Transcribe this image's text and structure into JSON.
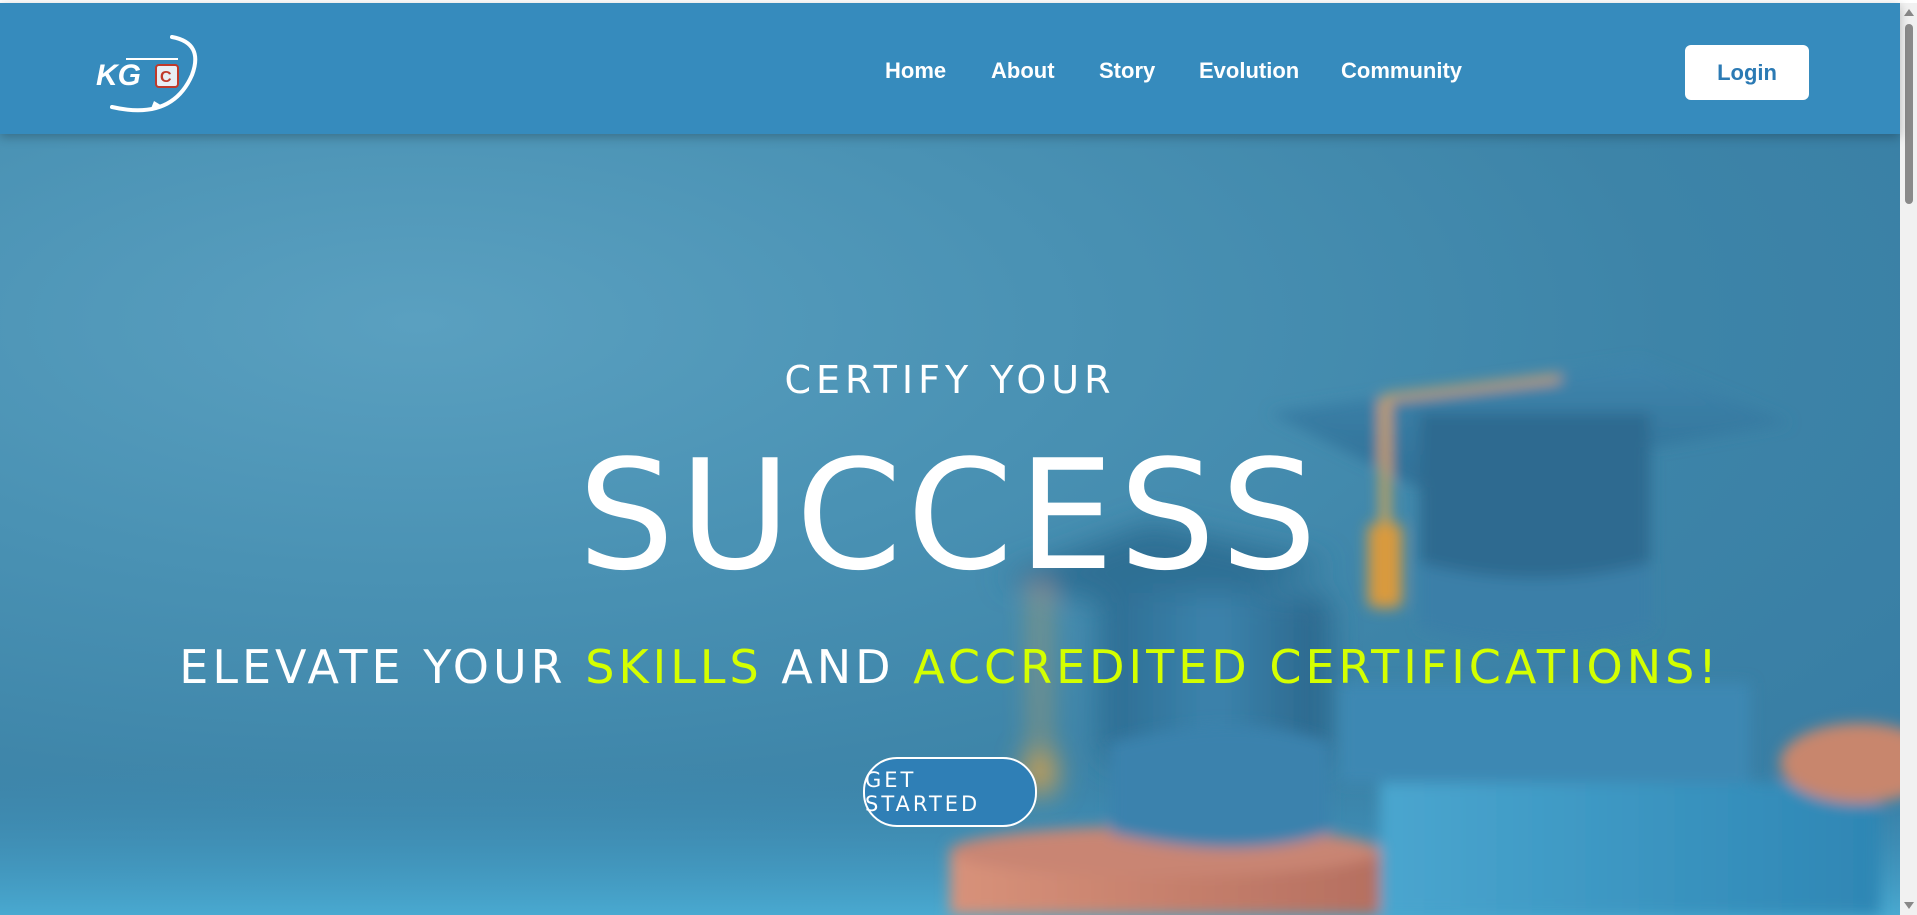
{
  "nav": {
    "logo_alt": "KGC",
    "links": [
      "Home",
      "About",
      "Story",
      "Evolution",
      "Community"
    ],
    "login_label": "Login"
  },
  "hero": {
    "line1": "CERTIFY YOUR",
    "line2": "SUCCESS",
    "line3_parts": [
      "ELEVATE YOUR ",
      "SKILLS",
      " AND ",
      "ACCREDITED CERTIFICATIONS!"
    ],
    "cta_label": "GET STARTED"
  },
  "colors": {
    "nav_bg": "#368bbd",
    "accent": "#d4ff00",
    "login_text": "#2b7ab4",
    "cta_bg": "#2f7fb6"
  },
  "icons": [
    "kgc-logo",
    "graduation-cap-image",
    "scroll-up-arrow",
    "scroll-down-arrow"
  ]
}
